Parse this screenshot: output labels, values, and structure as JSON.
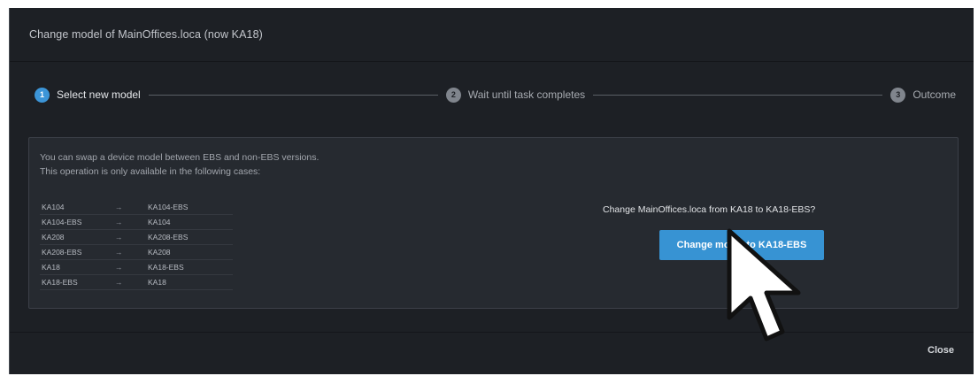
{
  "dialog": {
    "title": "Change model of MainOffices.loca (now KA18)",
    "close_label": "Close"
  },
  "stepper": {
    "steps": [
      {
        "number": "1",
        "label": "Select new model",
        "active": true
      },
      {
        "number": "2",
        "label": "Wait until task completes",
        "active": false
      },
      {
        "number": "3",
        "label": "Outcome",
        "active": false
      }
    ]
  },
  "info": {
    "line1": "You can swap a device model between EBS and non-EBS versions.",
    "line2": "This operation is only available in the following cases:"
  },
  "swap_table": {
    "rows": [
      {
        "from": "KA104",
        "arrow": "→",
        "to": "KA104-EBS"
      },
      {
        "from": "KA104-EBS",
        "arrow": "→",
        "to": "KA104"
      },
      {
        "from": "KA208",
        "arrow": "→",
        "to": "KA208-EBS"
      },
      {
        "from": "KA208-EBS",
        "arrow": "→",
        "to": "KA208"
      },
      {
        "from": "KA18",
        "arrow": "→",
        "to": "KA18-EBS"
      },
      {
        "from": "KA18-EBS",
        "arrow": "→",
        "to": "KA18"
      }
    ]
  },
  "action": {
    "question": "Change MainOffices.loca from KA18 to KA18-EBS?",
    "button_label": "Change model to KA18-EBS"
  },
  "colors": {
    "accent": "#3793d3",
    "dialog_bg": "#1d2025",
    "panel_bg": "#262a30"
  },
  "icons": {
    "cursor": "mouse-pointer-arrow-icon"
  }
}
